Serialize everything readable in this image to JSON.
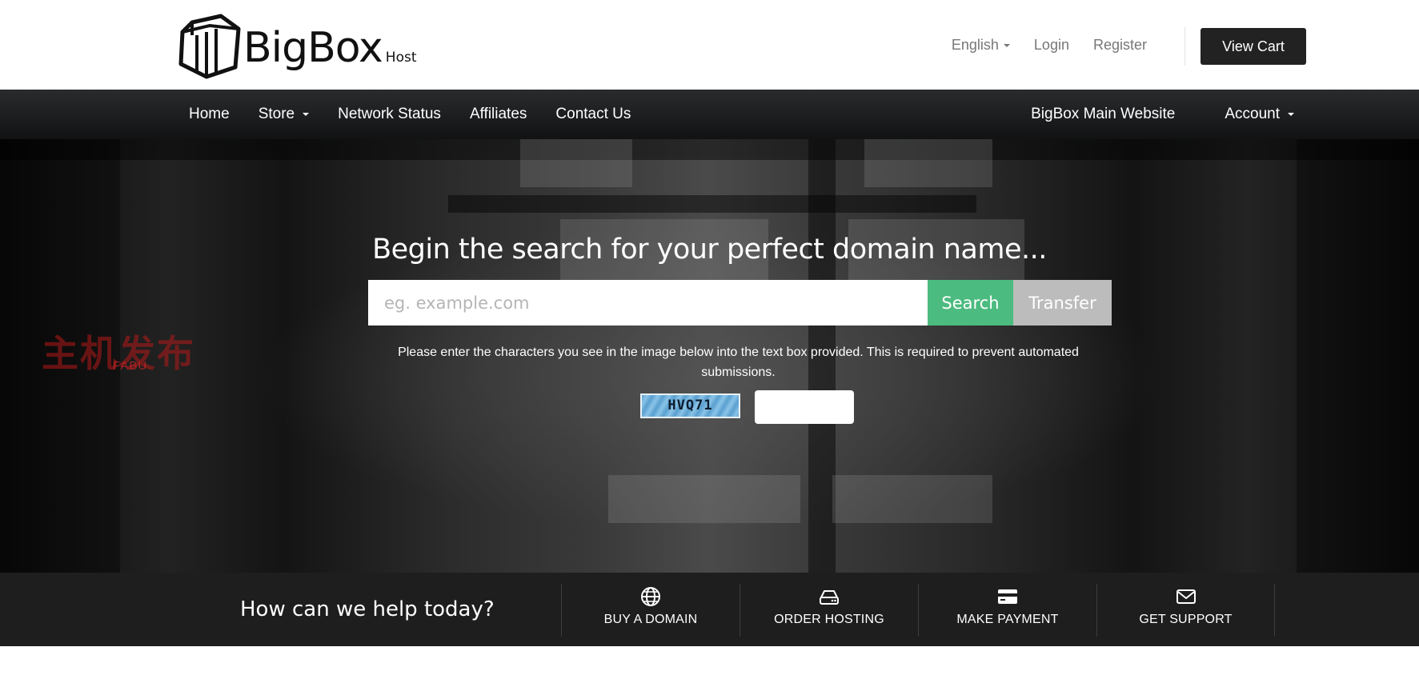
{
  "brand": {
    "name": "BigBox",
    "sub": "Host"
  },
  "header": {
    "language": "English",
    "login": "Login",
    "register": "Register",
    "view_cart": "View Cart"
  },
  "nav": {
    "home": "Home",
    "store": "Store",
    "network_status": "Network Status",
    "affiliates": "Affiliates",
    "contact": "Contact Us",
    "main_website": "BigBox Main Website",
    "account": "Account"
  },
  "hero": {
    "title": "Begin the search for your perfect domain name...",
    "search_placeholder": "eg. example.com",
    "search_value": "",
    "search_button": "Search",
    "transfer_button": "Transfer",
    "captcha_instructions": "Please enter the characters you see in the image below into the text box provided. This is required to prevent automated submissions.",
    "captcha_code": "HVQ71",
    "captcha_value": "",
    "watermark": "主机发布",
    "watermark_sub": "FABU"
  },
  "help": {
    "title": "How can we help today?",
    "tiles": [
      {
        "label": "BUY A DOMAIN",
        "icon": "globe-icon"
      },
      {
        "label": "ORDER HOSTING",
        "icon": "server-icon"
      },
      {
        "label": "MAKE PAYMENT",
        "icon": "credit-card-icon"
      },
      {
        "label": "GET SUPPORT",
        "icon": "envelope-icon"
      }
    ]
  },
  "colors": {
    "accent_search": "#4cbb7f",
    "transfer": "#bcbcbc",
    "cart_button": "#222222",
    "nav_bg": "#1b1c1e",
    "help_bg": "#1e1e1e"
  }
}
